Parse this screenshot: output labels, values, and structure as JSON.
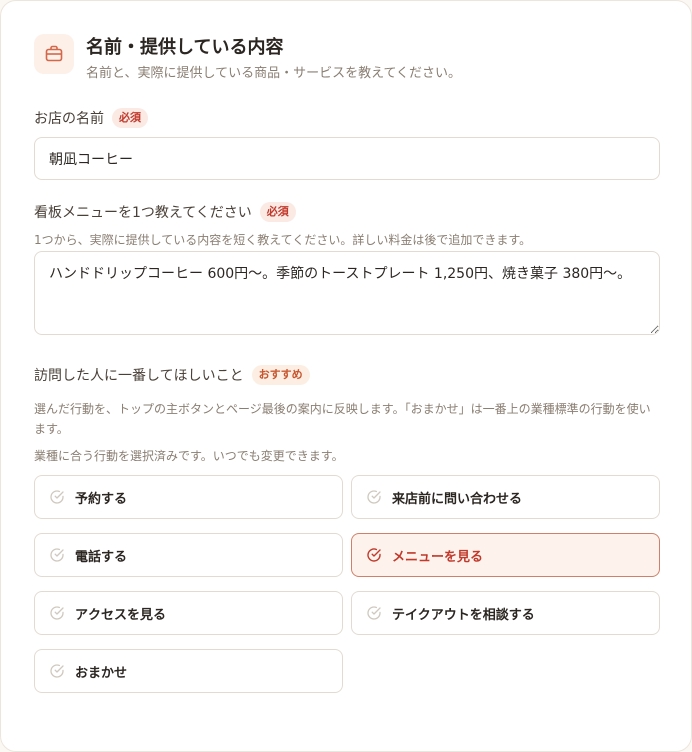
{
  "header": {
    "title": "名前・提供している内容",
    "subtitle": "名前と、実際に提供している商品・サービスを教えてください。",
    "icon": "briefcase-icon"
  },
  "shop_name": {
    "label": "お店の名前",
    "badge": "必須",
    "value": "朝凪コーヒー"
  },
  "signature_menu": {
    "label": "看板メニューを1つ教えてください",
    "badge": "必須",
    "hint": "1つから、実際に提供している内容を短く教えてください。詳しい料金は後で追加できます。",
    "value": "ハンドドリップコーヒー 600円〜。季節のトーストプレート 1,250円、焼き菓子 380円〜。"
  },
  "visitor_action": {
    "label": "訪問した人に一番してほしいこと",
    "badge": "おすすめ",
    "description": "選んだ行動を、トップの主ボタンとページ最後の案内に反映します。「おまかせ」は一番上の業種標準の行動を使います。",
    "note": "業種に合う行動を選択済みです。いつでも変更できます。",
    "options": [
      {
        "label": "予約する",
        "selected": false
      },
      {
        "label": "来店前に問い合わせる",
        "selected": false
      },
      {
        "label": "電話する",
        "selected": false
      },
      {
        "label": "メニューを見る",
        "selected": true
      },
      {
        "label": "アクセスを見る",
        "selected": false
      },
      {
        "label": "テイクアウトを相談する",
        "selected": false
      },
      {
        "label": "おまかせ",
        "selected": false
      }
    ]
  },
  "colors": {
    "accent": "#c0392b",
    "selected_bg": "#fdf2ec",
    "border": "#e2dbd2"
  }
}
